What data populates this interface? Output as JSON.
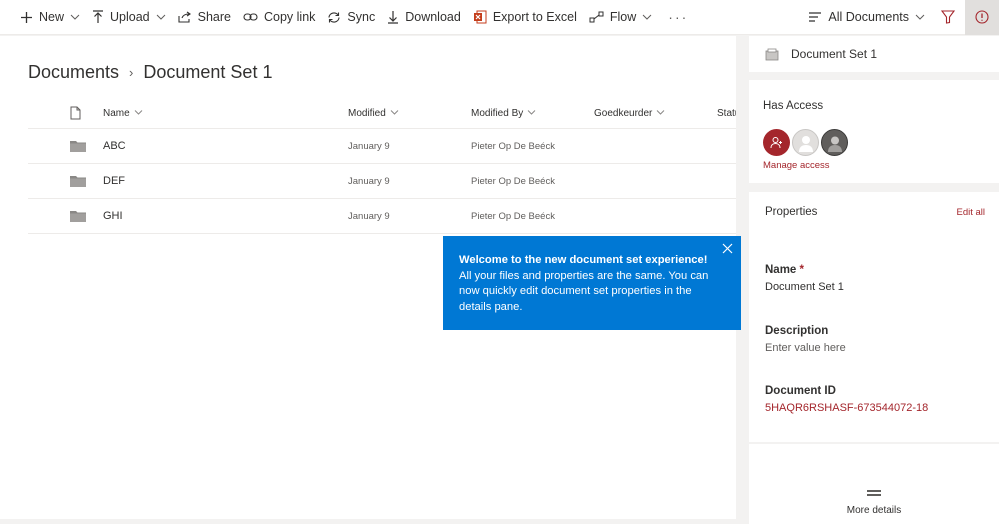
{
  "command_bar": {
    "new_label": "New",
    "upload_label": "Upload",
    "share_label": "Share",
    "copy_link_label": "Copy link",
    "sync_label": "Sync",
    "download_label": "Download",
    "export_label": "Export to Excel",
    "flow_label": "Flow",
    "more_label": "···",
    "view_label": "All Documents"
  },
  "breadcrumb": {
    "root": "Documents",
    "separator": "›",
    "current": "Document Set 1"
  },
  "list": {
    "columns": {
      "name": "Name",
      "modified": "Modified",
      "modified_by": "Modified By",
      "goedkeurder": "Goedkeurder",
      "status": "Status"
    },
    "rows": [
      {
        "name": "ABC",
        "modified": "January 9",
        "modified_by": "Pieter Op De Beéck",
        "goedkeurder": ""
      },
      {
        "name": "DEF",
        "modified": "January 9",
        "modified_by": "Pieter Op De Beéck",
        "goedkeurder": ""
      },
      {
        "name": "GHI",
        "modified": "January 9",
        "modified_by": "Pieter Op De Beéck",
        "goedkeurder": ""
      }
    ]
  },
  "teaching_bubble": {
    "title": "Welcome to the new document set experience!",
    "body": "All your files and properties are the same. You can now quickly edit document set properties in the details pane."
  },
  "details_pane": {
    "title": "Document Set 1",
    "has_access_label": "Has Access",
    "manage_access_label": "Manage access",
    "properties_label": "Properties",
    "edit_all_label": "Edit all",
    "fields": {
      "name_label": "Name",
      "name_required": "*",
      "name_value": "Document Set 1",
      "description_label": "Description",
      "description_placeholder": "Enter value here",
      "document_id_label": "Document ID",
      "document_id_value": "5HAQR6RSHASF-673544072-18"
    },
    "more_details_label": "More details"
  },
  "colors": {
    "accent_blue": "#0078d4",
    "accent_red": "#a4262c",
    "excel_green": "#c43e1c"
  }
}
